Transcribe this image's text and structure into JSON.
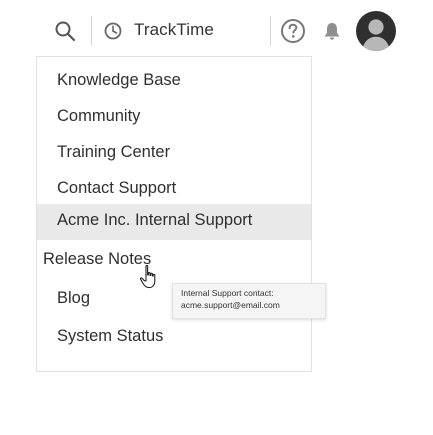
{
  "header": {
    "search_icon": "search-icon",
    "clock_icon": "clock-icon",
    "product_label": "TrackTime",
    "help_icon": "help-icon",
    "notifications_icon": "bell-icon",
    "avatar_icon": "user-avatar"
  },
  "menu": {
    "items": [
      {
        "label": "Knowledge Base"
      },
      {
        "label": "Community"
      },
      {
        "label": "Training Center"
      },
      {
        "label": "Contact Support"
      },
      {
        "label": "Acme Inc. Internal Support"
      },
      {
        "label": "Release Notes"
      },
      {
        "label": "Blog"
      },
      {
        "label": "System Status"
      }
    ],
    "hovered_index": 4
  },
  "tooltip": {
    "line1": "Internal Support contact:",
    "line2": "acme.support@email.com"
  },
  "colors": {
    "hover_bg": "#e9e9e9",
    "avatar_bg": "#2f2f2f",
    "icon_gray": "#9a9a9a"
  }
}
